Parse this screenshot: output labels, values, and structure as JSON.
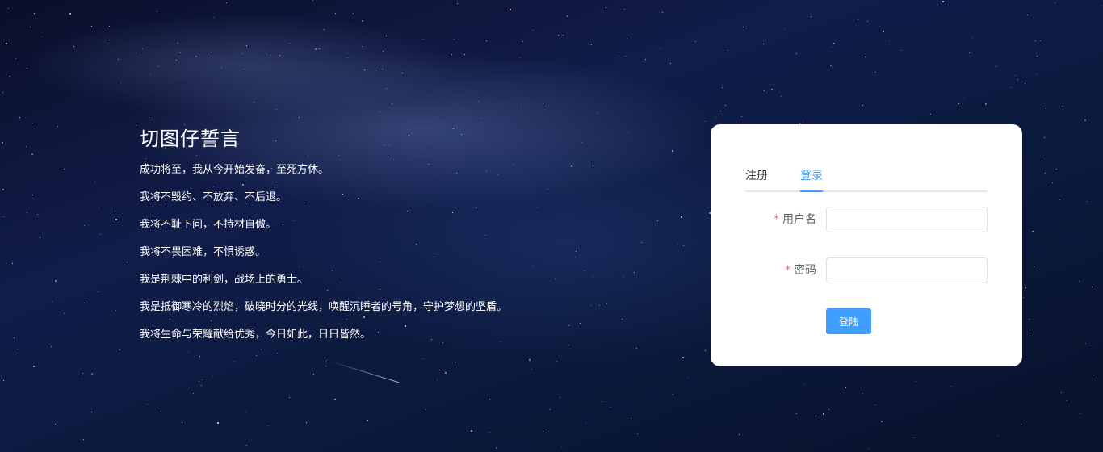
{
  "oath": {
    "title": "切图仔誓言",
    "lines": [
      "成功将至，我从今开始发奋，至死方休。",
      "我将不毁约、不放弃、不后退。",
      "我将不耻下问，不持材自傲。",
      "我将不畏困难，不惧诱惑。",
      "我是荆棘中的利剑，战场上的勇士。",
      "我是抵御寒冷的烈焰，破晓时分的光线，唤醒沉睡者的号角，守护梦想的坚盾。",
      "我将生命与荣耀献给优秀，今日如此，日日皆然。"
    ]
  },
  "login_card": {
    "tabs": [
      {
        "label": "注册",
        "active": false
      },
      {
        "label": "登录",
        "active": true
      }
    ],
    "required_mark": "*",
    "username": {
      "label": "用户名",
      "value": "",
      "placeholder": ""
    },
    "password": {
      "label": "密码",
      "value": "",
      "placeholder": ""
    },
    "submit_label": "登陆"
  },
  "colors": {
    "accent": "#409eff",
    "required": "#f56c6c",
    "card_bg": "#ffffff",
    "oath_text": "#ffffff"
  }
}
